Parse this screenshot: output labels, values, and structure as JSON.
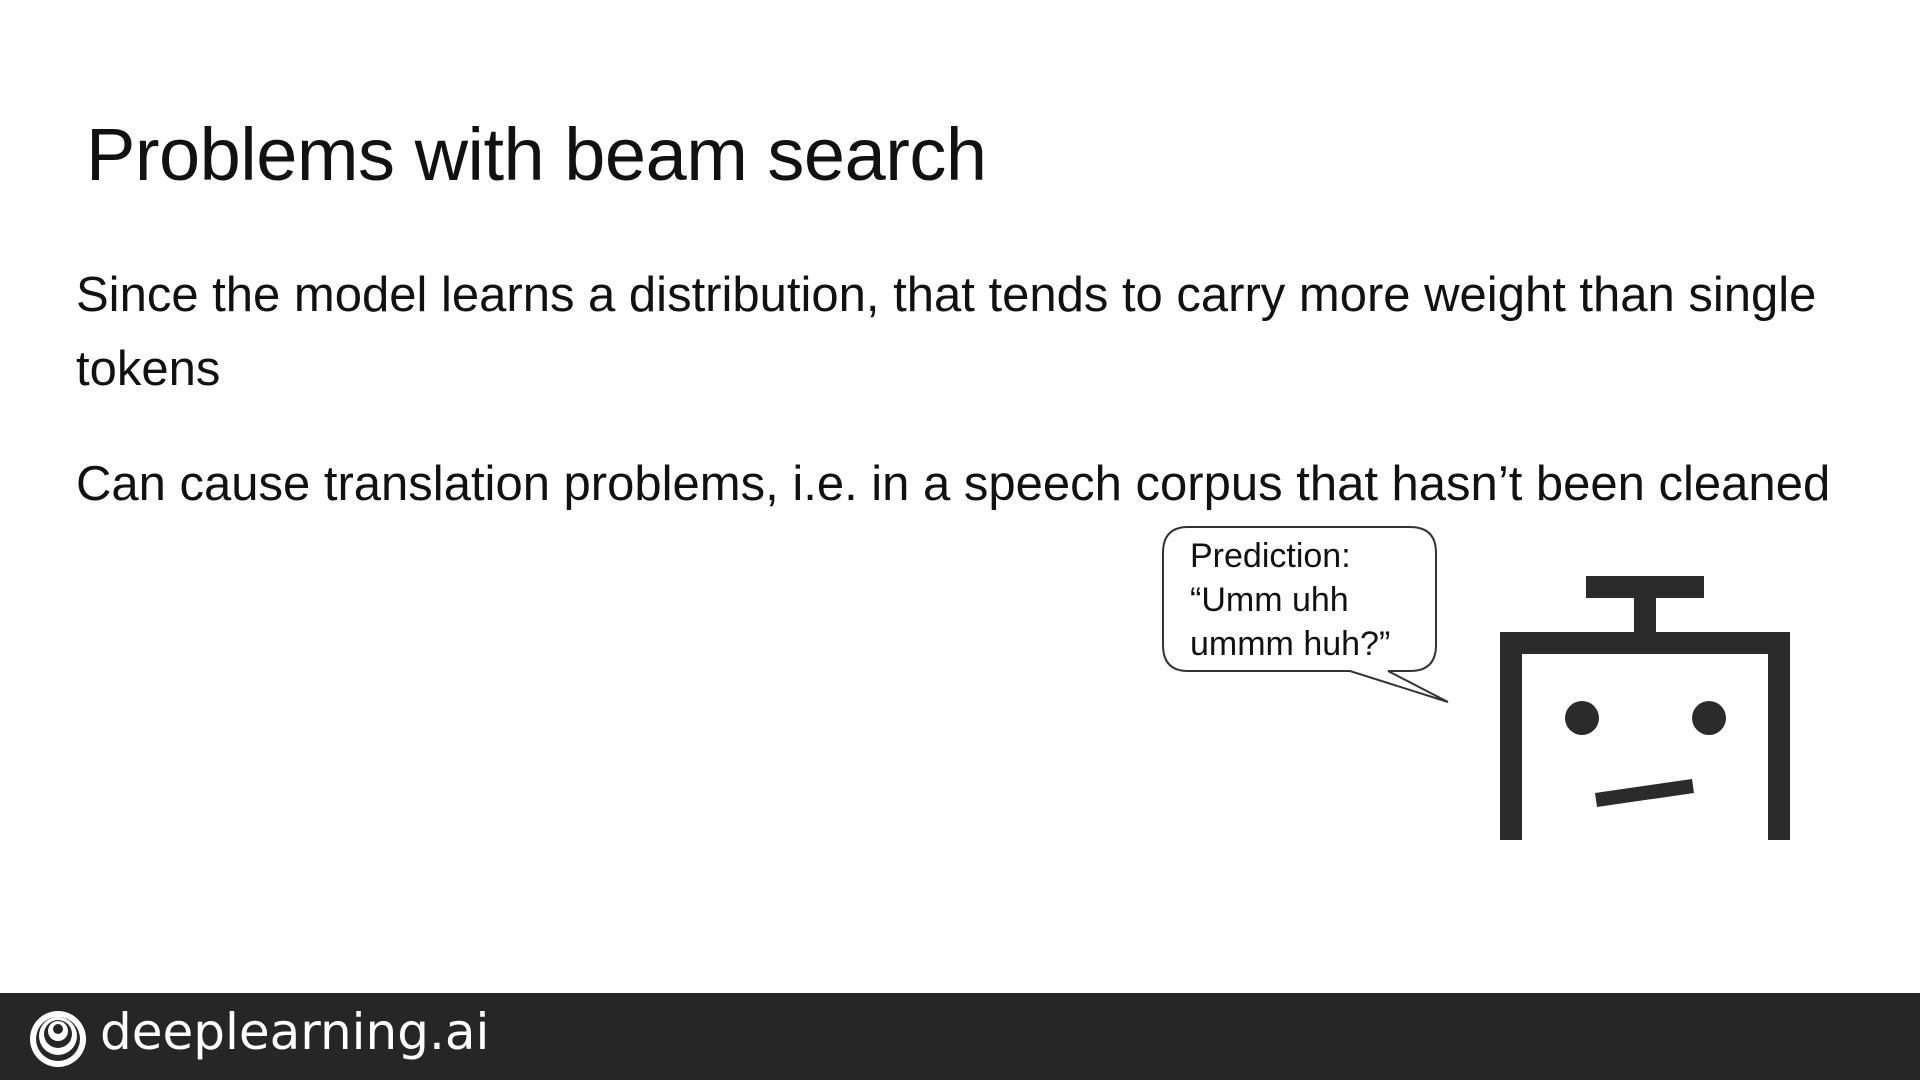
{
  "slide": {
    "title": "Problems with beam search",
    "bullets": [
      "Since the model learns a distribution, that tends to carry more weight than single tokens",
      "Can cause translation problems, i.e. in a speech corpus that hasn’t been cleaned"
    ]
  },
  "speech_bubble": {
    "lines": [
      "Prediction:",
      "“Umm uhh",
      "ummm huh?”"
    ]
  },
  "footer": {
    "brand": "deeplearning.ai",
    "logo_icon": "deeplearning-spiral-logo-icon"
  },
  "colors": {
    "background": "#ffffff",
    "text": "#111111",
    "robot": "#2b2b2b",
    "footer_bg": "#262626",
    "footer_text": "#ffffff"
  }
}
